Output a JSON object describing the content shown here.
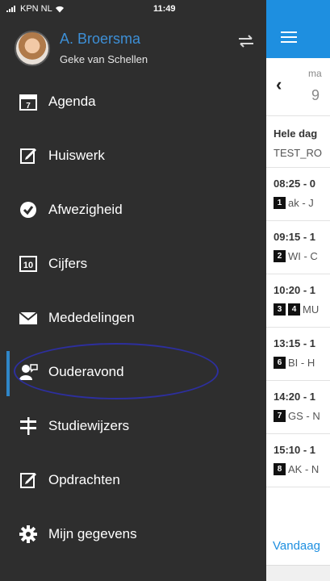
{
  "status_bar": {
    "carrier": "KPN NL",
    "time": "11:49"
  },
  "profile": {
    "name": "A. Broersma",
    "child": "Geke van Schellen"
  },
  "menu": {
    "items": [
      {
        "label": "Agenda",
        "icon": "calendar-icon"
      },
      {
        "label": "Huiswerk",
        "icon": "edit-icon"
      },
      {
        "label": "Afwezigheid",
        "icon": "check-circle-icon"
      },
      {
        "label": "Cijfers",
        "icon": "grades-icon"
      },
      {
        "label": "Mededelingen",
        "icon": "envelope-icon"
      },
      {
        "label": "Ouderavond",
        "icon": "parent-meeting-icon",
        "active": true
      },
      {
        "label": "Studiewijzers",
        "icon": "signpost-icon"
      },
      {
        "label": "Opdrachten",
        "icon": "edit-icon"
      },
      {
        "label": "Mijn gegevens",
        "icon": "gear-icon"
      }
    ]
  },
  "content": {
    "date": {
      "dow": "ma",
      "day": "9"
    },
    "rows": [
      {
        "time": "Hele dag",
        "detail": "TEST_RO",
        "badges": []
      },
      {
        "time": "08:25 - 0",
        "detail": "ak - J",
        "badges": [
          "1"
        ]
      },
      {
        "time": "09:15 - 1",
        "detail": "WI - C",
        "badges": [
          "2"
        ]
      },
      {
        "time": "10:20 - 1",
        "detail": "MU",
        "badges": [
          "3",
          "4"
        ]
      },
      {
        "time": "13:15 - 1",
        "detail": "BI - H",
        "badges": [
          "6"
        ]
      },
      {
        "time": "14:20 - 1",
        "detail": "GS - N",
        "badges": [
          "7"
        ]
      },
      {
        "time": "15:10 - 1",
        "detail": "AK - N",
        "badges": [
          "8"
        ]
      }
    ],
    "today_label": "Vandaag"
  },
  "colors": {
    "drawer_bg": "#2e2e2e",
    "accent": "#1e8fe0",
    "name_blue": "#3d8fd6",
    "highlight": "#2d2f9e"
  }
}
